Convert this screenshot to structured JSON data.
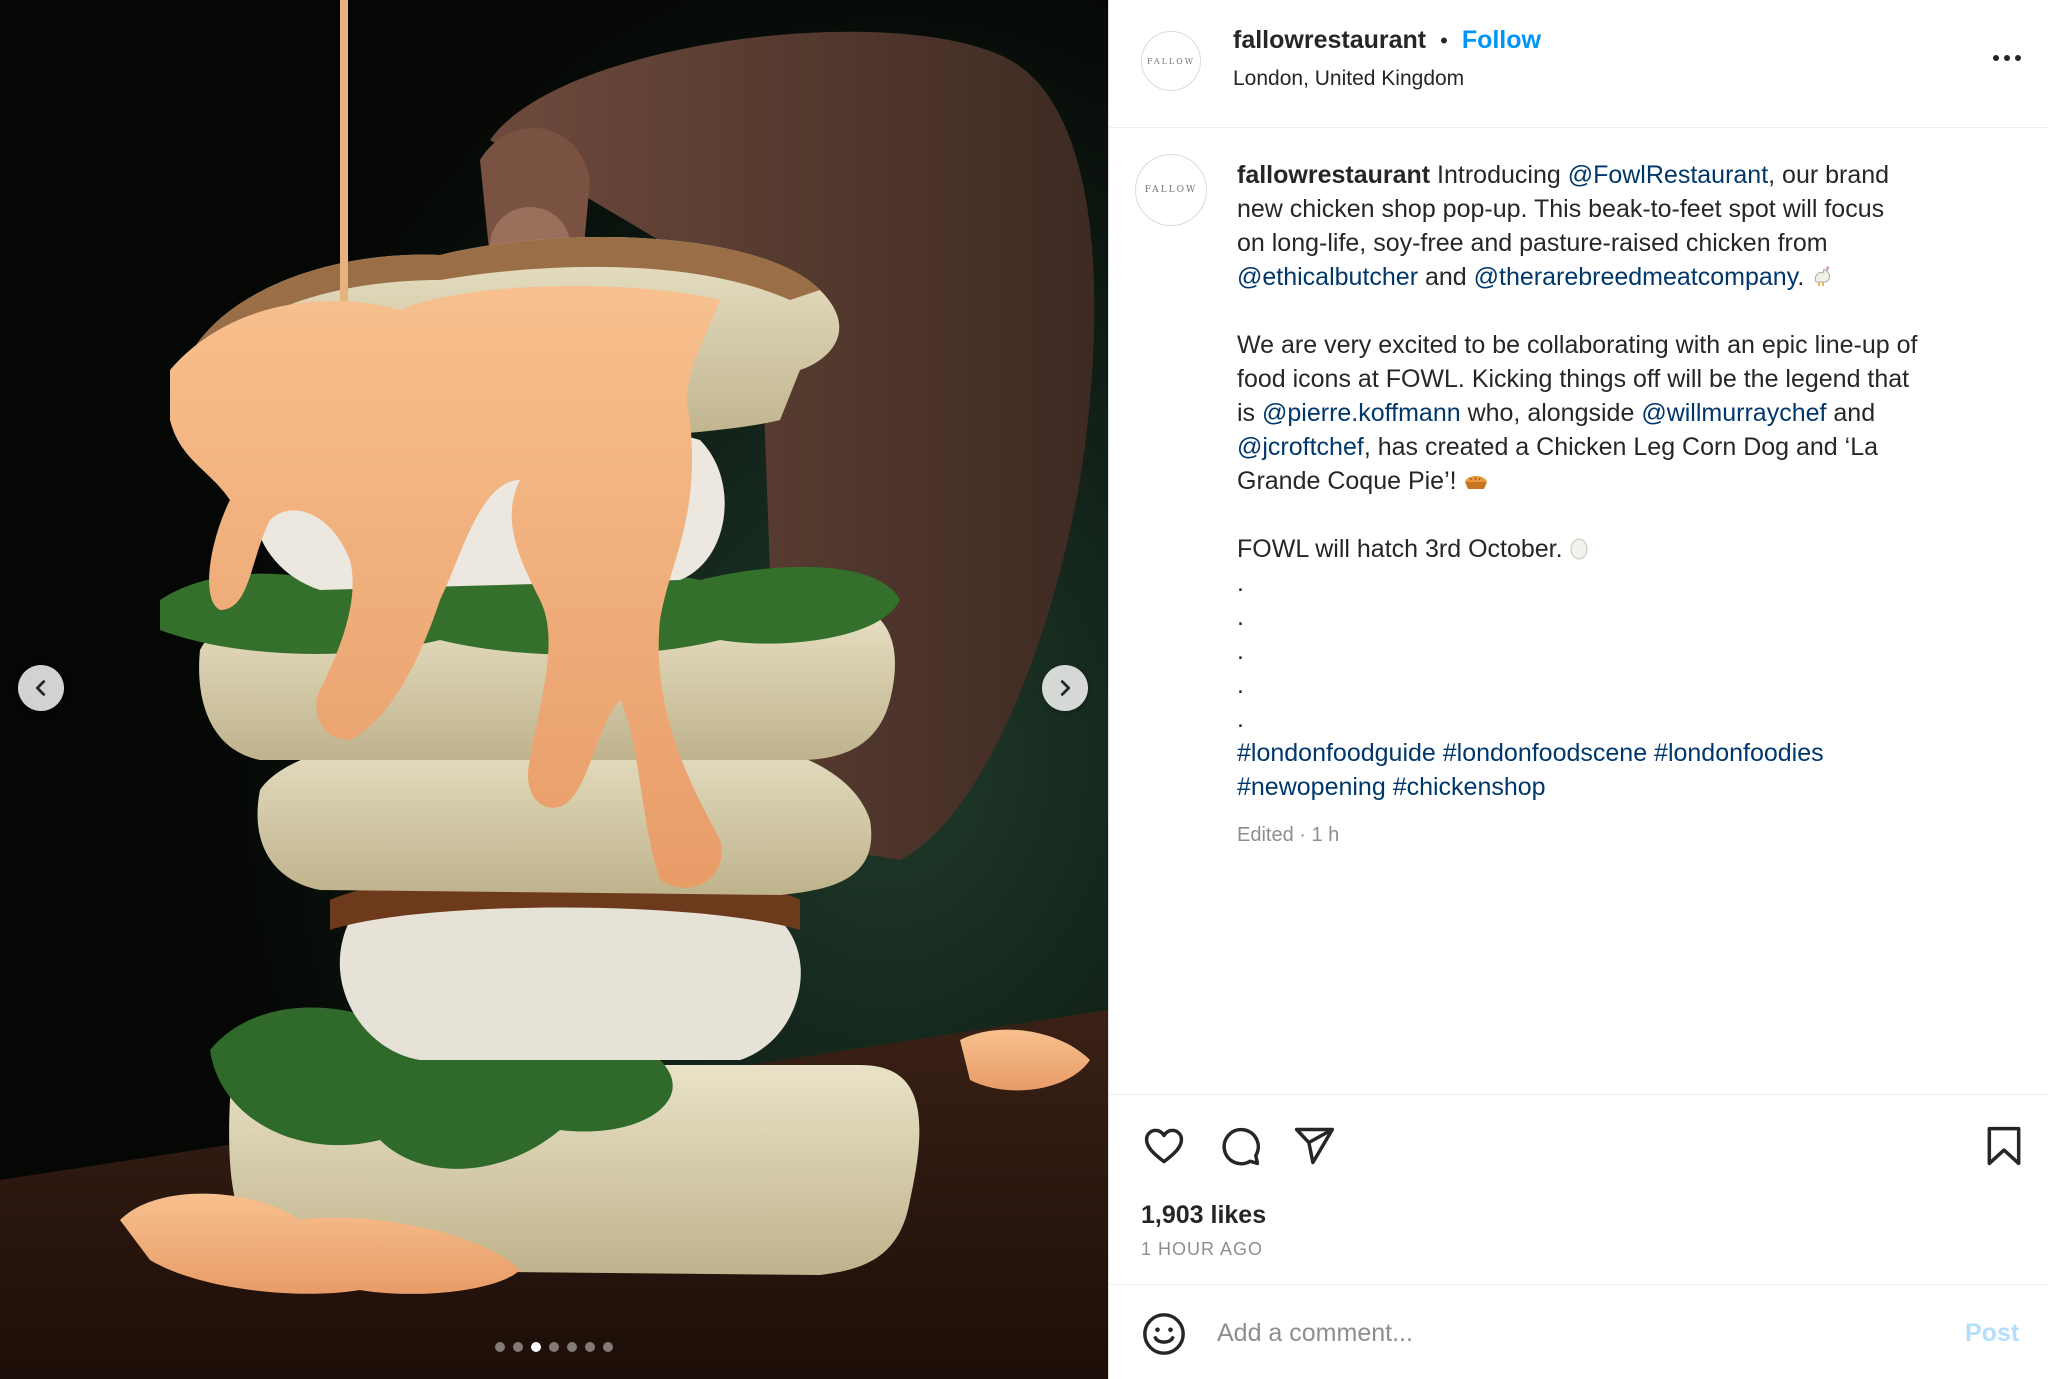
{
  "post": {
    "username": "fallowrestaurant",
    "follow_label": "Follow",
    "separator": "•",
    "location": "London, United Kingdom",
    "avatar_text": "FALLOW"
  },
  "caption": {
    "username": "fallowrestaurant",
    "l1": {
      "a": " Introducing ",
      "m1": "@FowlRestaurant",
      "b": ", our brand"
    },
    "l2": "new chicken shop pop-up. This beak-to-feet spot will focus",
    "l3": "on long-life, soy-free and pasture-raised chicken from",
    "l4": {
      "m1": "@ethicalbutcher",
      "a": " and ",
      "m2": "@therarebreedmeatcompany",
      "b": "."
    },
    "l5": "We are very excited to be collaborating with an epic line-up of",
    "l6": "food icons at FOWL. Kicking things off will be the legend that",
    "l7": {
      "a": "is ",
      "m1": "@pierre.koffmann",
      "b": " who, alongside ",
      "m2": "@willmurraychef",
      "c": " and"
    },
    "l8": {
      "m1": "@jcroftchef",
      "a": ", has created a Chicken Leg Corn Dog and ‘La"
    },
    "l9": "Grande Coque Pie’!",
    "l10": "FOWL will hatch 3rd October.",
    "dots": [
      ".",
      ".",
      ".",
      ".",
      "."
    ],
    "tags1": "#londonfoodguide #londonfoodscene #londonfoodies",
    "tags2": "#newopening #chickenshop",
    "edited": "Edited · 1 h"
  },
  "icons": {
    "like": "heart-icon",
    "comment": "comment-icon",
    "share": "send-icon",
    "save": "bookmark-icon",
    "more": "more-icon",
    "emoji": "smile-icon",
    "prev": "chevron-left-icon",
    "next": "chevron-right-icon",
    "caption_emojis": [
      "rooster-emoji",
      "pie-emoji",
      "egg-emoji"
    ]
  },
  "stats": {
    "likes": "1,903 likes",
    "time": "1 HOUR AGO"
  },
  "comment_box": {
    "placeholder": "Add a comment...",
    "post_label": "Post"
  },
  "carousel": {
    "count": 7,
    "active_index": 2
  },
  "colors": {
    "link": "#0095f6",
    "mention": "#00376b",
    "muted": "#8e8e8e",
    "post_disabled": "#b2dffc"
  }
}
